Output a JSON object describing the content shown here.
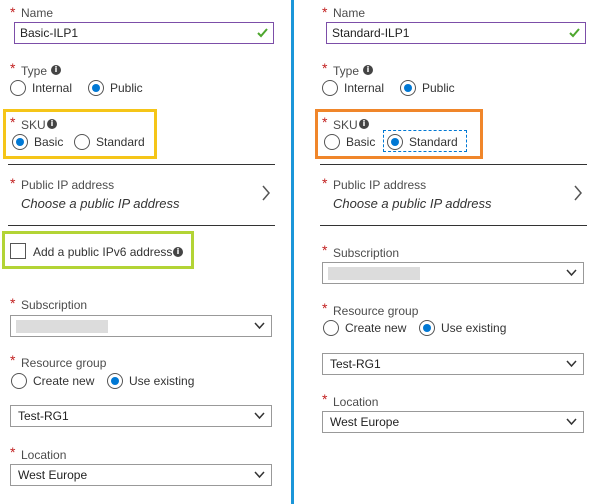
{
  "colors": {
    "divider": "#1b96d9",
    "radio_selected": "#0078d4",
    "required_asterisk": "#c21f1f",
    "valid_check": "#4ea72e",
    "highlight_sku_left": "#f5c518",
    "highlight_ipv6": "#b3d435",
    "highlight_sku_right": "#f0862a"
  },
  "required_marker": "*",
  "info_glyph": "i",
  "left": {
    "name_label": "Name",
    "name_value": "Basic-ILP1",
    "type_label": "Type",
    "type_options": [
      "Internal",
      "Public"
    ],
    "type_selected": "Public",
    "sku_label": "SKU",
    "sku_options": [
      "Basic",
      "Standard"
    ],
    "sku_selected": "Basic",
    "public_ip_label": "Public IP address",
    "public_ip_value": "Choose a public IP address",
    "ipv6_label": "Add a public IPv6 address",
    "subscription_label": "Subscription",
    "resource_group_label": "Resource group",
    "rg_options": [
      "Create new",
      "Use existing"
    ],
    "rg_selected": "Use existing",
    "rg_value": "Test-RG1",
    "location_label": "Location",
    "location_value": "West Europe"
  },
  "right": {
    "name_label": "Name",
    "name_value": "Standard-ILP1",
    "type_label": "Type",
    "type_options": [
      "Internal",
      "Public"
    ],
    "type_selected": "Public",
    "sku_label": "SKU",
    "sku_options": [
      "Basic",
      "Standard"
    ],
    "sku_selected": "Standard",
    "public_ip_label": "Public IP address",
    "public_ip_value": "Choose a public IP address",
    "subscription_label": "Subscription",
    "resource_group_label": "Resource group",
    "rg_options": [
      "Create new",
      "Use existing"
    ],
    "rg_selected": "Use existing",
    "rg_value": "Test-RG1",
    "location_label": "Location",
    "location_value": "West Europe"
  }
}
